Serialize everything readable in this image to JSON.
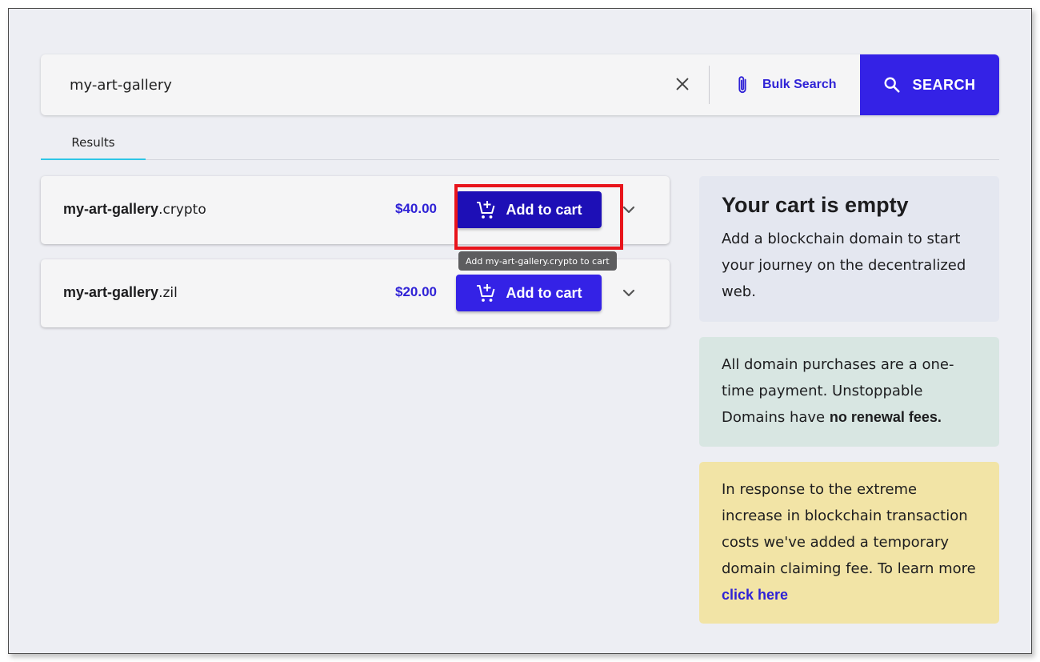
{
  "search": {
    "value": "my-art-gallery",
    "bulk_label": "Bulk Search",
    "button_label": "SEARCH"
  },
  "tabs": [
    {
      "label": "Results"
    }
  ],
  "results": [
    {
      "base": "my-art-gallery",
      "tld": ".crypto",
      "price": "$40.00",
      "button_label": "Add to cart"
    },
    {
      "base": "my-art-gallery",
      "tld": ".zil",
      "price": "$20.00",
      "button_label": "Add to cart"
    }
  ],
  "tooltip": "Add my-art-gallery.crypto to cart",
  "cart": {
    "title": "Your cart is empty",
    "text": "Add a blockchain domain to start your journey on the decentralized web."
  },
  "info": {
    "text": "All domain purchases are a one-time payment. Unstoppable Domains have ",
    "bold": "no renewal fees."
  },
  "notice": {
    "text": "In response to the extreme increase in blockchain transaction costs we've added a temporary domain claiming fee. To learn more ",
    "link": "click here"
  },
  "icons": {
    "clear": "close-icon",
    "bulk": "paperclip-icon",
    "search": "search-icon",
    "cart": "add-shopping-cart-icon",
    "expand": "chevron-down-icon"
  },
  "colors": {
    "accent": "#3422e6",
    "accent_pressed": "#1d0fb6",
    "tab_indicator": "#2fc6e6",
    "highlight": "#e8141b",
    "cart_panel": "#e4e7f0",
    "info_panel": "#d8e6e2",
    "notice_panel": "#f2e4a6"
  }
}
